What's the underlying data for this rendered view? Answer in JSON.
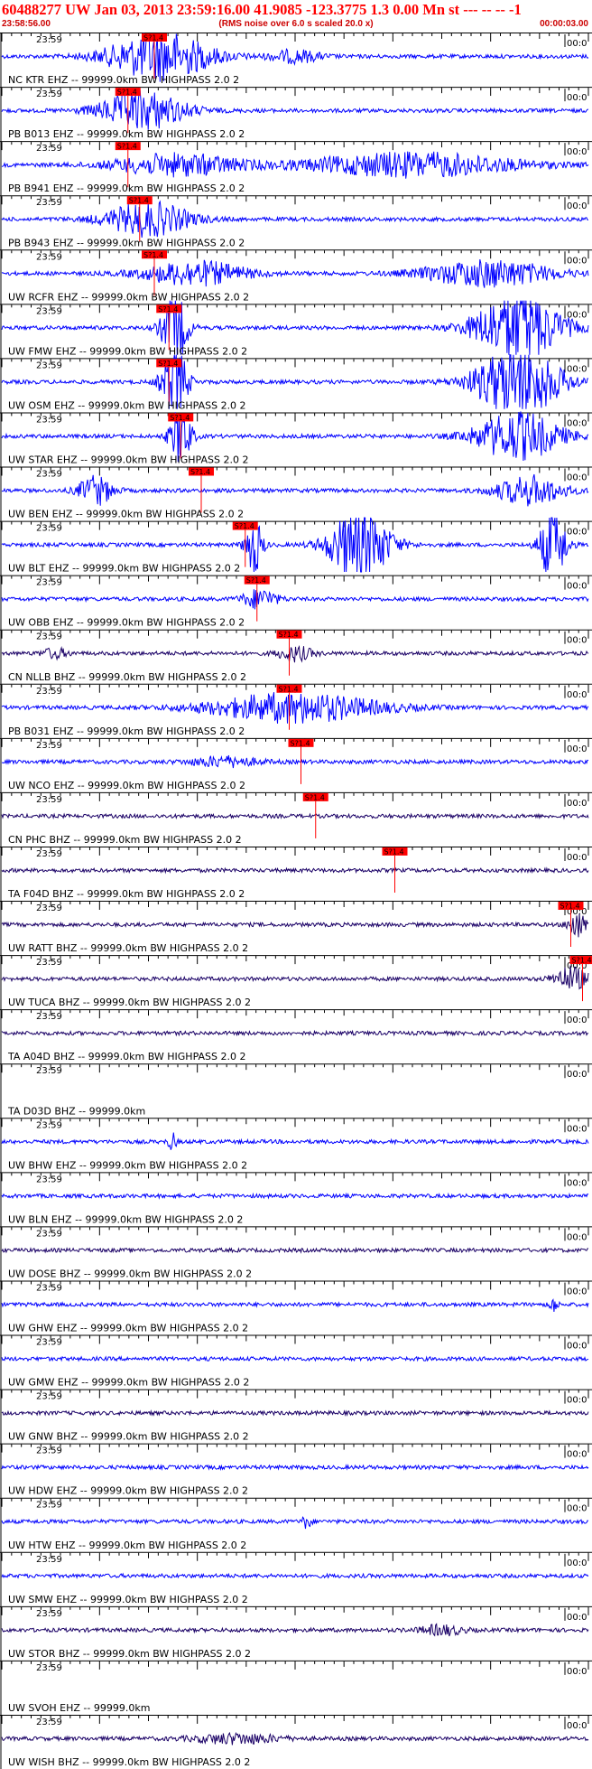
{
  "header": {
    "title": "60488277 UW Jan 03, 2013 23:59:16.00   41.9085 -123.3775  1.3 0.00 Mn st --- -- --   -1",
    "start_time": "23:58:56.00",
    "scale_note": "(RMS noise over 6.0 s scaled 20.0 x)",
    "duration": "00:00:03.00"
  },
  "colors": {
    "trace_blue": "#0000ff",
    "trace_navy": "#1a0066",
    "pick_red": "#ff0000",
    "title_red": "#ff0000",
    "axis": "#000000"
  },
  "chart_data": {
    "type": "line",
    "title": "60488277 UW Jan 03, 2013 23:59:16.00   41.9085 -123.3775  1.3 0.00 Mn st --- -- --   -1",
    "x_units": "time",
    "xlim": [
      "23:58:56.00",
      "+00:00:03.00 per window"
    ],
    "grid": false,
    "start_tick_label": "23:59",
    "end_tick_label": "00:0",
    "pick_label": "S?1.4",
    "panels": [
      {
        "label": "NC KTR  EHZ -- 99999.0km BW  HIGHPASS  2.0  2",
        "color": "blue",
        "pick": 0.26,
        "events": [
          {
            "c": 0.27,
            "w": 0.12,
            "a": 1.0
          },
          {
            "c": 0.5,
            "w": 0.06,
            "a": 0.25
          }
        ]
      },
      {
        "label": "PB B013 EHZ -- 99999.0km BW  HIGHPASS  2.0  2",
        "color": "blue",
        "pick": 0.215,
        "events": [
          {
            "c": 0.24,
            "w": 0.1,
            "a": 0.8
          }
        ]
      },
      {
        "label": "PB B941 EHZ -- 99999.0km BW  HIGHPASS  2.0  2",
        "color": "blue",
        "pick": 0.215,
        "events": [
          {
            "c": 0.3,
            "w": 0.15,
            "a": 0.45
          },
          {
            "c": 0.7,
            "w": 0.25,
            "a": 0.5
          }
        ]
      },
      {
        "label": "PB B943 EHZ -- 99999.0km BW  HIGHPASS  2.0  2",
        "color": "blue",
        "pick": 0.235,
        "events": [
          {
            "c": 0.25,
            "w": 0.1,
            "a": 0.7
          }
        ]
      },
      {
        "label": "UW RCFR EHZ -- 99999.0km BW  HIGHPASS  2.0  2",
        "color": "blue",
        "pick": 0.26,
        "events": [
          {
            "c": 0.33,
            "w": 0.12,
            "a": 0.5
          },
          {
            "c": 0.83,
            "w": 0.15,
            "a": 0.55
          }
        ]
      },
      {
        "label": "UW FMW  EHZ -- 99999.0km BW  HIGHPASS  2.0  2",
        "color": "blue",
        "pick": 0.285,
        "events": [
          {
            "c": 0.295,
            "w": 0.03,
            "a": 1.5
          },
          {
            "c": 0.88,
            "w": 0.1,
            "a": 1.5
          }
        ]
      },
      {
        "label": "UW OSM  EHZ -- 99999.0km BW  HIGHPASS  2.0  2",
        "color": "blue",
        "pick": 0.285,
        "events": [
          {
            "c": 0.295,
            "w": 0.03,
            "a": 1.5
          },
          {
            "c": 0.88,
            "w": 0.1,
            "a": 1.5
          }
        ]
      },
      {
        "label": "UW STAR EHZ -- 99999.0km BW  HIGHPASS  2.0  2",
        "color": "blue",
        "pick": 0.305,
        "events": [
          {
            "c": 0.305,
            "w": 0.025,
            "a": 1.2
          },
          {
            "c": 0.88,
            "w": 0.1,
            "a": 1.0
          }
        ]
      },
      {
        "label": "UW BEN  EHZ -- 99999.0km BW  HIGHPASS  2.0  2",
        "color": "blue",
        "pick": 0.34,
        "events": [
          {
            "c": 0.16,
            "w": 0.04,
            "a": 0.6
          },
          {
            "c": 0.9,
            "w": 0.08,
            "a": 0.6
          }
        ]
      },
      {
        "label": "UW BLT  EHZ -- 99999.0km BW  HIGHPASS  2.0  2",
        "color": "blue",
        "pick": 0.415,
        "events": [
          {
            "c": 0.43,
            "w": 0.02,
            "a": 1.2
          },
          {
            "c": 0.61,
            "w": 0.07,
            "a": 1.6
          },
          {
            "c": 0.94,
            "w": 0.03,
            "a": 1.6
          }
        ]
      },
      {
        "label": "UW OBB  EHZ -- 99999.0km BW  HIGHPASS  2.0  2",
        "color": "blue",
        "pick": 0.435,
        "events": [
          {
            "c": 0.44,
            "w": 0.04,
            "a": 0.4
          }
        ]
      },
      {
        "label": "CN NLLB BHZ -- 99999.0km BW  HIGHPASS  2.0  2",
        "color": "navy",
        "pick": 0.49,
        "events": [
          {
            "c": 0.5,
            "w": 0.04,
            "a": 0.3
          },
          {
            "c": 0.09,
            "w": 0.03,
            "a": 0.2
          }
        ]
      },
      {
        "label": "PB B031 EHZ -- 99999.0km BW  HIGHPASS  2.0  2",
        "color": "blue",
        "pick": 0.49,
        "events": [
          {
            "c": 0.5,
            "w": 0.2,
            "a": 0.6
          }
        ]
      },
      {
        "label": "UW NCO  EHZ -- 99999.0km BW  HIGHPASS  2.0  2",
        "color": "blue",
        "pick": 0.51,
        "events": [
          {
            "c": 0.38,
            "w": 0.08,
            "a": 0.2
          }
        ]
      },
      {
        "label": "CN PHC  BHZ -- 99999.0km BW  HIGHPASS  2.0  2",
        "color": "navy",
        "pick": 0.535,
        "events": []
      },
      {
        "label": "TA F04D BHZ -- 99999.0km BW  HIGHPASS  2.0  2",
        "color": "navy",
        "pick": 0.67,
        "events": []
      },
      {
        "label": "UW RATT BHZ -- 99999.0km BW  HIGHPASS  2.0  2",
        "color": "navy",
        "pick": 0.97,
        "events": [
          {
            "c": 0.98,
            "w": 0.02,
            "a": 0.6
          }
        ]
      },
      {
        "label": "UW TUCA BHZ -- 99999.0km BW  HIGHPASS  2.0  2",
        "color": "navy",
        "pick": 0.99,
        "events": [
          {
            "c": 0.97,
            "w": 0.04,
            "a": 0.5
          }
        ]
      },
      {
        "label": "TA A04D BHZ -- 99999.0km BW  HIGHPASS  2.0  2",
        "color": "navy",
        "pick": null,
        "events": []
      },
      {
        "label": "TA D03D BHZ -- 99999.0km",
        "color": "navy",
        "pick": null,
        "flat": true,
        "events": []
      },
      {
        "label": "UW BHW  EHZ -- 99999.0km BW  HIGHPASS  2.0  2",
        "color": "blue",
        "pick": null,
        "events": [
          {
            "c": 0.29,
            "w": 0.01,
            "a": 0.35
          }
        ]
      },
      {
        "label": "UW BLN  EHZ -- 99999.0km BW  HIGHPASS  2.0  2",
        "color": "blue",
        "pick": null,
        "events": []
      },
      {
        "label": "UW DOSE BHZ -- 99999.0km BW  HIGHPASS  2.0  2",
        "color": "navy",
        "pick": null,
        "events": []
      },
      {
        "label": "UW GHW  EHZ -- 99999.0km BW  HIGHPASS  2.0  2",
        "color": "blue",
        "pick": null,
        "events": [
          {
            "c": 0.94,
            "w": 0.01,
            "a": 0.3
          }
        ]
      },
      {
        "label": "UW GMW  EHZ -- 99999.0km BW  HIGHPASS  2.0  2",
        "color": "blue",
        "pick": null,
        "events": []
      },
      {
        "label": "UW GNW  BHZ -- 99999.0km BW  HIGHPASS  2.0  2",
        "color": "navy",
        "pick": null,
        "events": []
      },
      {
        "label": "UW HDW  EHZ -- 99999.0km BW  HIGHPASS  2.0  2",
        "color": "blue",
        "pick": null,
        "events": []
      },
      {
        "label": "UW HTW  EHZ -- 99999.0km BW  HIGHPASS  2.0  2",
        "color": "blue",
        "pick": null,
        "events": [
          {
            "c": 0.52,
            "w": 0.01,
            "a": 0.3
          }
        ]
      },
      {
        "label": "UW SMW  EHZ -- 99999.0km BW  HIGHPASS  2.0  2",
        "color": "blue",
        "pick": null,
        "events": []
      },
      {
        "label": "UW STOR BHZ -- 99999.0km BW  HIGHPASS  2.0  2",
        "color": "navy",
        "pick": null,
        "events": [
          {
            "c": 0.75,
            "w": 0.05,
            "a": 0.2
          }
        ]
      },
      {
        "label": "UW SVOH EHZ -- 99999.0km",
        "color": "navy",
        "pick": null,
        "flat": true,
        "events": []
      },
      {
        "label": "UW WISH BHZ -- 99999.0km BW  HIGHPASS  2.0  2",
        "color": "navy",
        "pick": null,
        "events": [
          {
            "c": 0.4,
            "w": 0.1,
            "a": 0.2
          }
        ]
      }
    ]
  }
}
